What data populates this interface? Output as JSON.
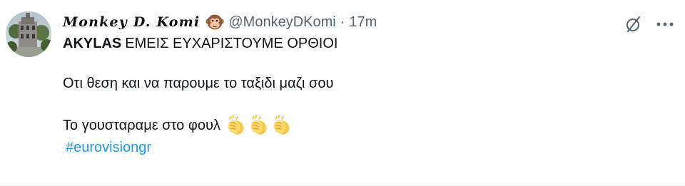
{
  "tweet": {
    "author": {
      "display_name": "Monkey D. Komi",
      "name_emoji": "monkey-face-emoji",
      "handle": "@MonkeyDKomi",
      "separator": "·",
      "time": "17m"
    },
    "icons": {
      "grok": "grok-icon",
      "more": "more-icon"
    },
    "body": {
      "line1_mention": "AKYLAS",
      "line1_text": "ΕΜΕΙΣ ΕΥΧΑΡΙΣΤΟΥΜΕ ΟΡΘΙΟΙ",
      "line2_text": "Οτι θεση και να παρουμε το ταξιδι μαζι σου",
      "line3_text": "Το γουσταραμε στο φουλ",
      "line3_emojis": [
        "clapping-hands-emoji",
        "clapping-hands-emoji",
        "clapping-hands-emoji"
      ],
      "hashtag": "#eurovisiongr"
    },
    "colors": {
      "text": "#0f1419",
      "secondary": "#536471",
      "link": "#1d9bf0"
    }
  }
}
